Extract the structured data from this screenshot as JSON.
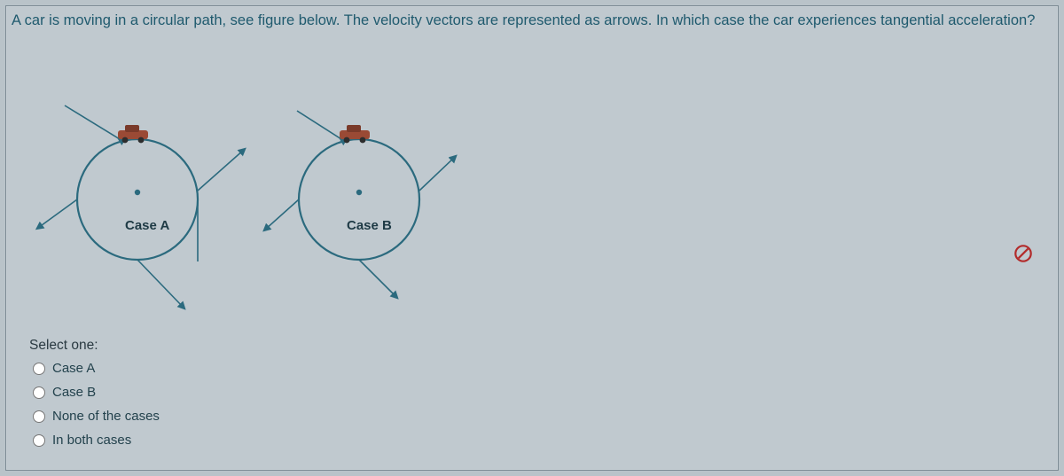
{
  "question": {
    "text": "A car is moving in a circular path, see figure below. The velocity vectors are represented as arrows. In which case the car experiences tangential acceleration?"
  },
  "figure": {
    "case_a_label": "Case A",
    "case_b_label": "Case B"
  },
  "prompt": {
    "select_one": "Select one:"
  },
  "options": [
    {
      "label": "Case A"
    },
    {
      "label": "Case B"
    },
    {
      "label": "None of the cases"
    },
    {
      "label": "In both cases"
    }
  ],
  "icons": {
    "flag": "flag-icon"
  }
}
